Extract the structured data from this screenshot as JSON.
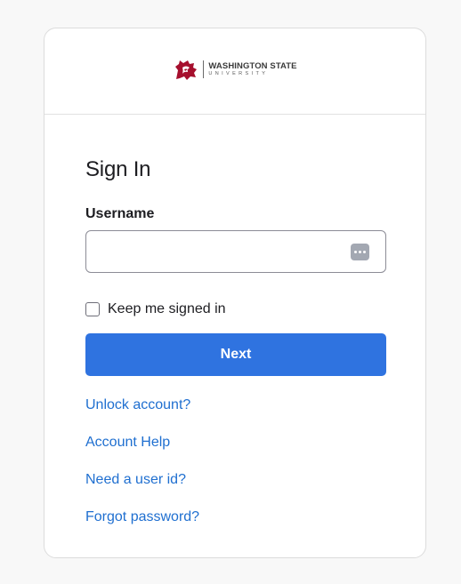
{
  "logo": {
    "line1": "WASHINGTON STATE",
    "line2": "UNIVERSITY",
    "brand_color": "#a60f2d"
  },
  "form": {
    "title": "Sign In",
    "username_label": "Username",
    "username_value": "",
    "password_manager_icon": "dots-icon",
    "keep_signed_in_label": "Keep me signed in",
    "keep_signed_in_checked": false,
    "next_label": "Next"
  },
  "links": {
    "unlock": "Unlock account?",
    "help": "Account Help",
    "user_id": "Need a user id?",
    "forgot": "Forgot password?"
  },
  "colors": {
    "primary_button": "#2f73e0",
    "link": "#1f6fd0"
  }
}
